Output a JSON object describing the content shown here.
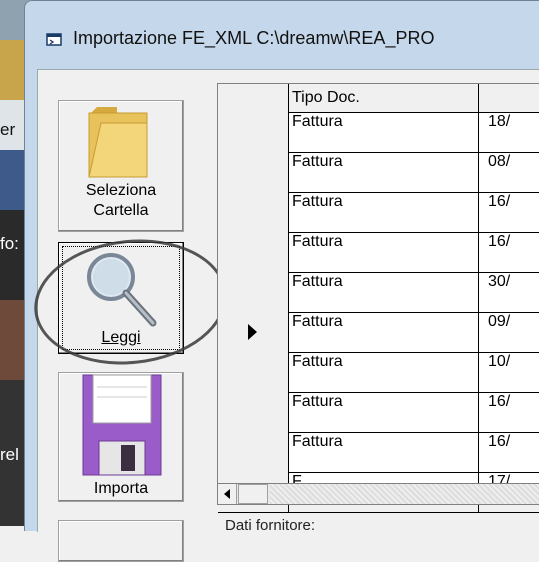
{
  "window": {
    "title": "Importazione FE_XML C:\\dreamw\\REA_PRO"
  },
  "desktop": {
    "fragments": [
      "er",
      "fo:",
      "rel"
    ]
  },
  "toolbar": {
    "select_folder_label_1": "Seleziona",
    "select_folder_label_2": "Cartella",
    "read_label": "Leggi",
    "import_label": "Importa"
  },
  "grid": {
    "columns": [
      "Tipo Doc.",
      ""
    ],
    "rows": [
      {
        "tipo": "Fattura",
        "data": "18/"
      },
      {
        "tipo": "Fattura",
        "data": "08/"
      },
      {
        "tipo": "Fattura",
        "data": "16/"
      },
      {
        "tipo": "Fattura",
        "data": "16/"
      },
      {
        "tipo": "Fattura",
        "data": "30/"
      },
      {
        "tipo": "Fattura",
        "data": "09/",
        "current": true
      },
      {
        "tipo": "Fattura",
        "data": "10/"
      },
      {
        "tipo": "Fattura",
        "data": "16/"
      },
      {
        "tipo": "Fattura",
        "data": "16/"
      },
      {
        "tipo": "F",
        "data": "17/"
      }
    ]
  },
  "footer": {
    "dati_fornitore_label": "Dati fornitore:"
  },
  "colors": {
    "titlebar": "#c5d7ea",
    "folder": "#e8c25a",
    "floppy": "#9a5cc8"
  }
}
